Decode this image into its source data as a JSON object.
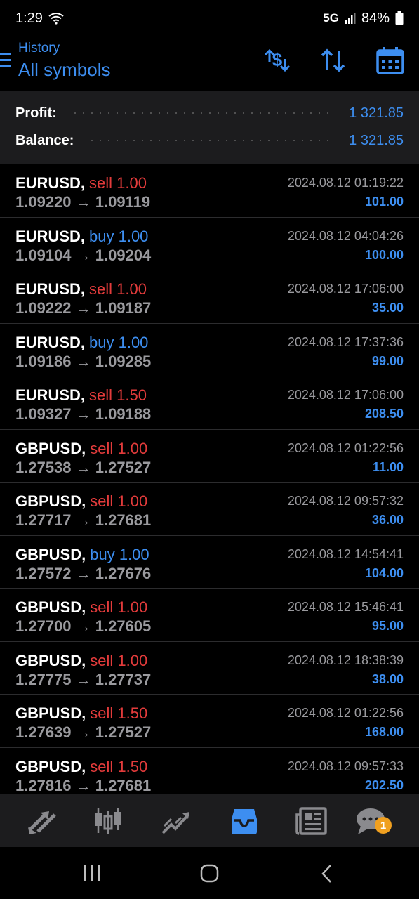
{
  "status": {
    "time": "1:29",
    "network": "5G",
    "battery": "84%"
  },
  "header": {
    "subtitle": "History",
    "title": "All symbols"
  },
  "summary": {
    "profit_label": "Profit:",
    "profit_value": "1 321.85",
    "balance_label": "Balance:",
    "balance_value": "1 321.85"
  },
  "deals": [
    {
      "symbol": "EURUSD,",
      "side": "sell 1.00",
      "type": "sell",
      "prices": "1.09220 → 1.09119",
      "time": "2024.08.12 01:19:22",
      "profit": "101.00"
    },
    {
      "symbol": "EURUSD,",
      "side": "buy 1.00",
      "type": "buy",
      "prices": "1.09104 → 1.09204",
      "time": "2024.08.12 04:04:26",
      "profit": "100.00"
    },
    {
      "symbol": "EURUSD,",
      "side": "sell 1.00",
      "type": "sell",
      "prices": "1.09222 → 1.09187",
      "time": "2024.08.12 17:06:00",
      "profit": "35.00"
    },
    {
      "symbol": "EURUSD,",
      "side": "buy 1.00",
      "type": "buy",
      "prices": "1.09186 → 1.09285",
      "time": "2024.08.12 17:37:36",
      "profit": "99.00"
    },
    {
      "symbol": "EURUSD,",
      "side": "sell 1.50",
      "type": "sell",
      "prices": "1.09327 → 1.09188",
      "time": "2024.08.12 17:06:00",
      "profit": "208.50"
    },
    {
      "symbol": "GBPUSD,",
      "side": "sell 1.00",
      "type": "sell",
      "prices": "1.27538 → 1.27527",
      "time": "2024.08.12 01:22:56",
      "profit": "11.00"
    },
    {
      "symbol": "GBPUSD,",
      "side": "sell 1.00",
      "type": "sell",
      "prices": "1.27717 → 1.27681",
      "time": "2024.08.12 09:57:32",
      "profit": "36.00"
    },
    {
      "symbol": "GBPUSD,",
      "side": "buy 1.00",
      "type": "buy",
      "prices": "1.27572 → 1.27676",
      "time": "2024.08.12 14:54:41",
      "profit": "104.00"
    },
    {
      "symbol": "GBPUSD,",
      "side": "sell 1.00",
      "type": "sell",
      "prices": "1.27700 → 1.27605",
      "time": "2024.08.12 15:46:41",
      "profit": "95.00"
    },
    {
      "symbol": "GBPUSD,",
      "side": "sell 1.00",
      "type": "sell",
      "prices": "1.27775 → 1.27737",
      "time": "2024.08.12 18:38:39",
      "profit": "38.00"
    },
    {
      "symbol": "GBPUSD,",
      "side": "sell 1.50",
      "type": "sell",
      "prices": "1.27639 → 1.27527",
      "time": "2024.08.12 01:22:56",
      "profit": "168.00"
    },
    {
      "symbol": "GBPUSD,",
      "side": "sell 1.50",
      "type": "sell",
      "prices": "1.27816 → 1.27681",
      "time": "2024.08.12 09:57:33",
      "profit": "202.50"
    }
  ],
  "nav": {
    "badge": "1",
    "active": "history"
  },
  "colors": {
    "accent": "#3d8ef0",
    "sell": "#e23b3b",
    "buy": "#3d8ef0"
  }
}
